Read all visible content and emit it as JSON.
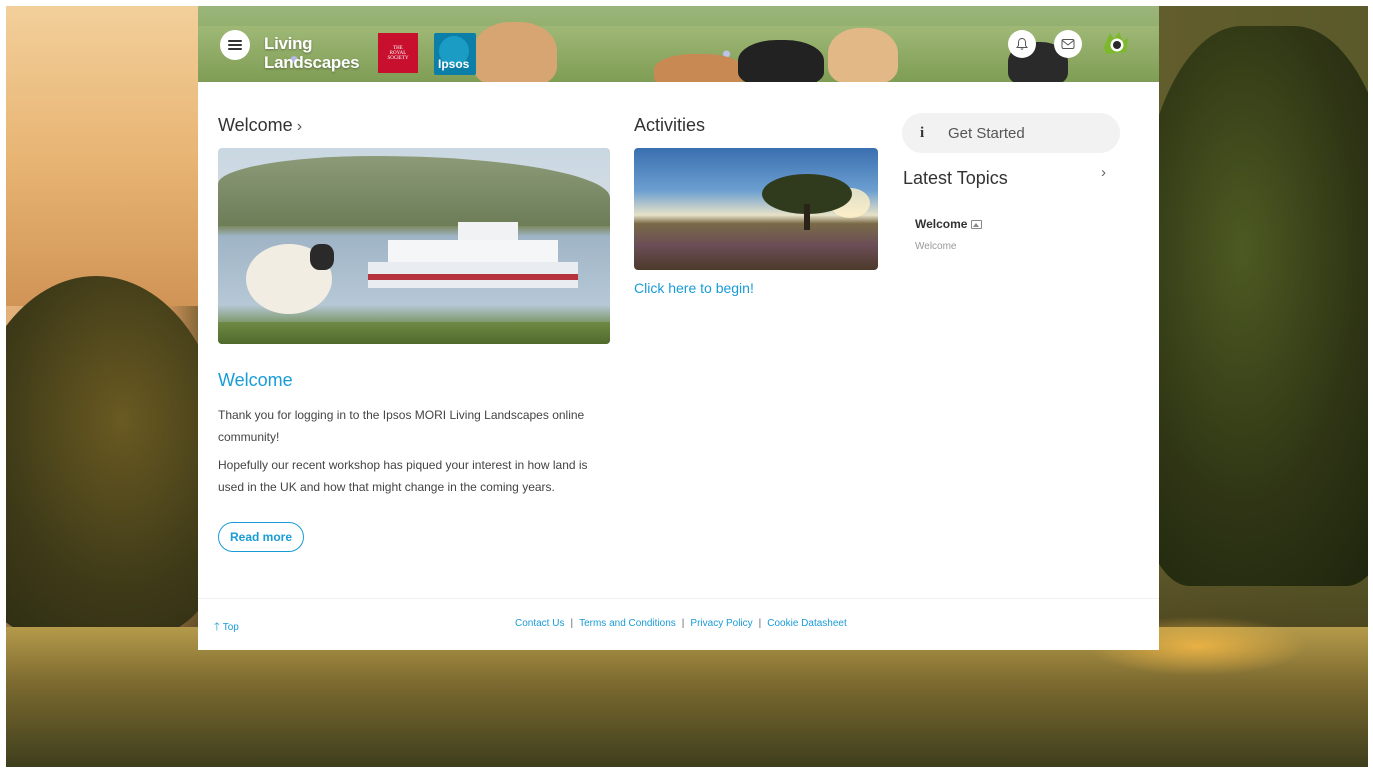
{
  "header": {
    "logo_line1": "Living",
    "logo_line2": "Landscapes",
    "royal_society_line1": "THE",
    "royal_society_line2": "ROYAL",
    "royal_society_line3": "SOCIETY",
    "ipsos_label": "Ipsos"
  },
  "welcome": {
    "heading": "Welcome",
    "chevron": "›",
    "title": "Welcome",
    "para1": "Thank you for logging in to the Ipsos MORI Living Landscapes online community!",
    "para2": "Hopefully our recent workshop has piqued your interest in how land is used in the UK and how that might change in the coming years.",
    "read_more": "Read more"
  },
  "activities": {
    "heading": "Activities",
    "link": "Click here to begin!"
  },
  "sidebar": {
    "get_started_icon": "i",
    "get_started": "Get Started",
    "latest_topics": "Latest Topics",
    "chevron": "›",
    "topics": [
      {
        "title": "Welcome",
        "subtitle": "Welcome"
      }
    ]
  },
  "footer": {
    "top": "Top",
    "links": [
      "Contact Us",
      "Terms and Conditions",
      "Privacy Policy",
      "Cookie Datasheet"
    ],
    "separator": "|"
  },
  "colors": {
    "accent": "#1a9bd7",
    "text": "#333333"
  }
}
